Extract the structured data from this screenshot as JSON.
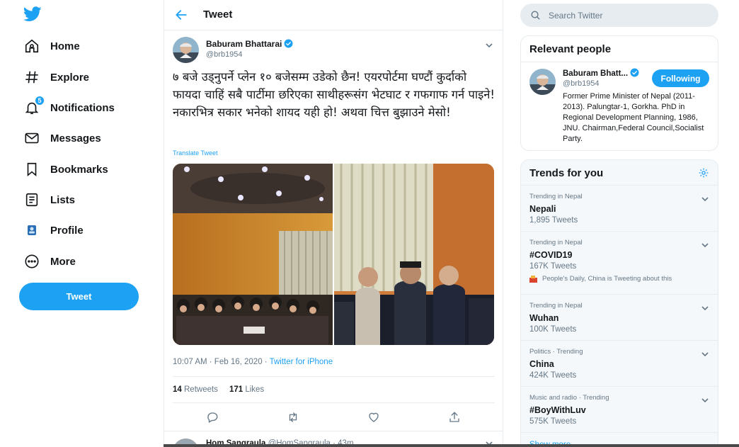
{
  "sidebar": {
    "logo": "twitter-bird-icon",
    "items": [
      {
        "label": "Home",
        "icon": "home-icon"
      },
      {
        "label": "Explore",
        "icon": "hashtag-icon"
      },
      {
        "label": "Notifications",
        "icon": "bell-icon",
        "badge": "5"
      },
      {
        "label": "Messages",
        "icon": "envelope-icon"
      },
      {
        "label": "Bookmarks",
        "icon": "bookmark-icon"
      },
      {
        "label": "Lists",
        "icon": "list-icon"
      },
      {
        "label": "Profile",
        "icon": "profile-avatar-icon"
      },
      {
        "label": "More",
        "icon": "more-dots-icon"
      }
    ],
    "tweet_button": "Tweet"
  },
  "header": {
    "back_icon": "back-arrow-icon",
    "title": "Tweet"
  },
  "tweet": {
    "author_name": "Baburam Bhattarai",
    "author_handle": "@brb1954",
    "verified": true,
    "text": "७ बजे उड्नुपर्ने प्लेन १० बजेसम्म उडेको छैन! एयरपोर्टमा घण्टौं कुर्दाको फायदा चाहिं सबै पार्टीमा छरिएका साथीहरूसंग भेटघाट र गफगाफ गर्न पाइने! नकारभित्र सकार भनेको शायद यही हो! अथवा चित्त बुझाउने मेसो!",
    "translate": "Translate Tweet",
    "time": "10:07 AM · Feb 16, 2020 · ",
    "source": "Twitter for iPhone",
    "retweets": "14",
    "retweets_label": "Retweets",
    "likes": "171",
    "likes_label": "Likes"
  },
  "reply": {
    "name": "Hom Sangraula",
    "handle_time": "@HomSangraula · 43m"
  },
  "search": {
    "placeholder": "Search Twitter"
  },
  "relevant": {
    "title": "Relevant people",
    "name": "Baburam Bhatt...",
    "handle": "@brb1954",
    "follow_label": "Following",
    "bio": "Former Prime Minister of Nepal (2011-2013). Palungtar-1, Gorkha. PhD in Regional Development Planning, 1986, JNU. Chairman,Federal Council,Socialist Party."
  },
  "trends": {
    "title": "Trends for you",
    "items": [
      {
        "meta": "Trending in Nepal",
        "name": "Nepali",
        "count": "1,895 Tweets"
      },
      {
        "meta": "Trending in Nepal",
        "name": "#COVID19",
        "count": "167K Tweets",
        "extra": "People's Daily, China is Tweeting about this"
      },
      {
        "meta": "Trending in Nepal",
        "name": "Wuhan",
        "count": "100K Tweets"
      },
      {
        "meta": "Politics · Trending",
        "name": "China",
        "count": "424K Tweets"
      },
      {
        "meta": "Music and radio · Trending",
        "name": "#BoyWithLuv",
        "count": "575K Tweets"
      }
    ],
    "show_more": "Show more"
  },
  "colors": {
    "accent": "#1da1f2",
    "text": "#14171a",
    "secondary": "#657786",
    "border": "#e6ecf0"
  }
}
